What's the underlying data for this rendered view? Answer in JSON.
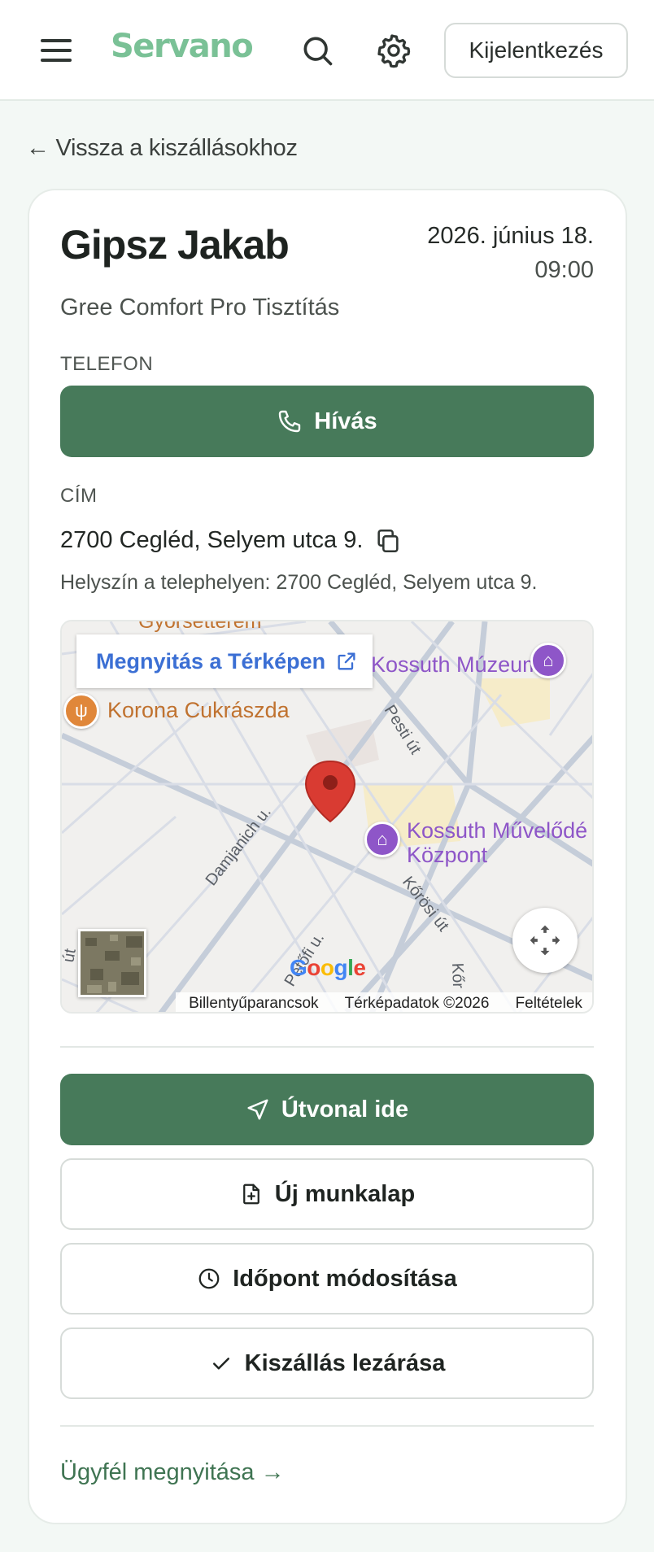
{
  "header": {
    "logo": "Servano",
    "menu_icon": "hamburger-menu-icon",
    "search_icon": "search-icon",
    "settings_icon": "gear-icon",
    "logout_label": "Kijelentkezés"
  },
  "back_link": "← Vissza a kiszállásokhoz",
  "visit": {
    "customer_name": "Gipsz Jakab",
    "date": "2026. június 18.",
    "time": "09:00",
    "service": "Gree Comfort Pro Tisztítás",
    "phone_label": "TELEFON",
    "call_label": "Hívás",
    "address_label": "CÍM",
    "address": "2700 Cegléd, Selyem utca 9.",
    "site_note": "Helyszín a telephelyen: 2700 Cegléd, Selyem utca 9."
  },
  "map": {
    "open_label": "Megnyitás a Térképen",
    "pois": {
      "top_cut": "Gyorsétterem",
      "museum": "Kossuth Múzeum",
      "cafe": "Korona Cukrászda",
      "culture_line1": "Kossuth Művelődé",
      "culture_line2": "Központ"
    },
    "streets": {
      "pesti": "Pesti út",
      "damjanich": "Damjanich u.",
      "korosi": "Kőrösi út",
      "petofi": "Petőfi u.",
      "ut_left": "út",
      "kor": "Kőr"
    },
    "google": "Google",
    "shortcuts": "Billentyűparancsok",
    "map_data": "Térképadatok ©2026",
    "terms": "Feltételek",
    "accent_colors": {
      "poi_purple": "#8e56c8",
      "poi_orange": "#e0873a",
      "pin": "#d93b32"
    }
  },
  "actions": {
    "route": "Útvonal ide",
    "new_worksheet": "Új munkalap",
    "reschedule": "Időpont módosítása",
    "close_visit": "Kiszállás lezárása"
  },
  "customer_link": "Ügyfél megnyitása →",
  "colors": {
    "brand": "#7ac196",
    "primary": "#477a5a",
    "link": "#3f7452",
    "map_link": "#3b6fd4"
  }
}
